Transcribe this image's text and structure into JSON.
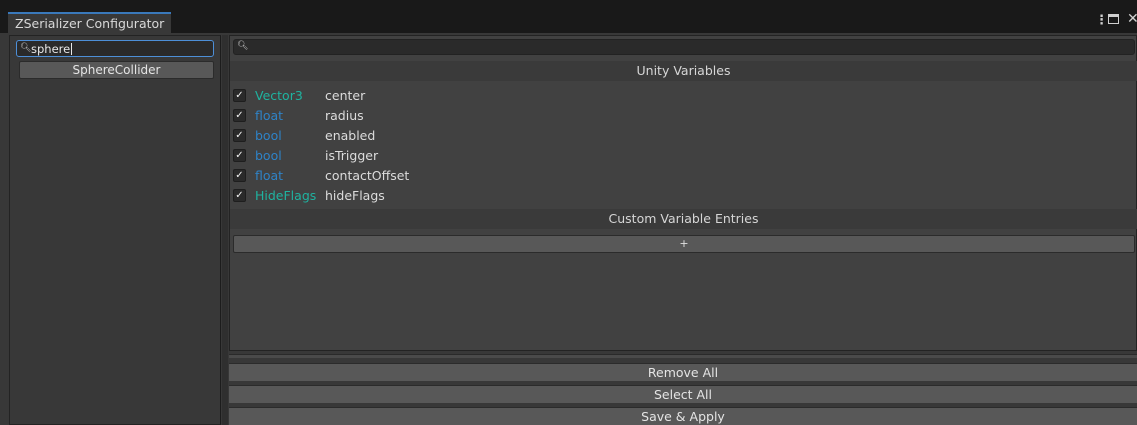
{
  "window": {
    "title": "ZSerializer Configurator",
    "menu_icon": "kebab-icon",
    "maximize_icon": "maximize-icon",
    "close_icon": "close-icon"
  },
  "left_panel": {
    "search": {
      "value": "sphere",
      "icon": "search-icon"
    },
    "classes": [
      {
        "label": "SphereCollider"
      }
    ]
  },
  "right_panel": {
    "search": {
      "value": "",
      "icon": "search-icon"
    },
    "unity_section_title": "Unity Variables",
    "variables": [
      {
        "checked": true,
        "type": "Vector3",
        "name": "center",
        "type_color": "#1fb3a0"
      },
      {
        "checked": true,
        "type": "float",
        "name": "radius",
        "type_color": "#2f83c7"
      },
      {
        "checked": true,
        "type": "bool",
        "name": "enabled",
        "type_color": "#2f83c7"
      },
      {
        "checked": true,
        "type": "bool",
        "name": "isTrigger",
        "type_color": "#2f83c7"
      },
      {
        "checked": true,
        "type": "float",
        "name": "contactOffset",
        "type_color": "#2f83c7"
      },
      {
        "checked": true,
        "type": "HideFlags",
        "name": "hideFlags",
        "type_color": "#1fb3a0"
      }
    ],
    "custom_section_title": "Custom Variable Entries",
    "add_entry_label": "+"
  },
  "actions": {
    "remove_all": "Remove All",
    "select_all": "Select All",
    "save_apply": "Save & Apply"
  },
  "colors": {
    "accent": "#3a79bb",
    "value_type": "#1fb3a0",
    "primitive_type": "#2f83c7"
  }
}
